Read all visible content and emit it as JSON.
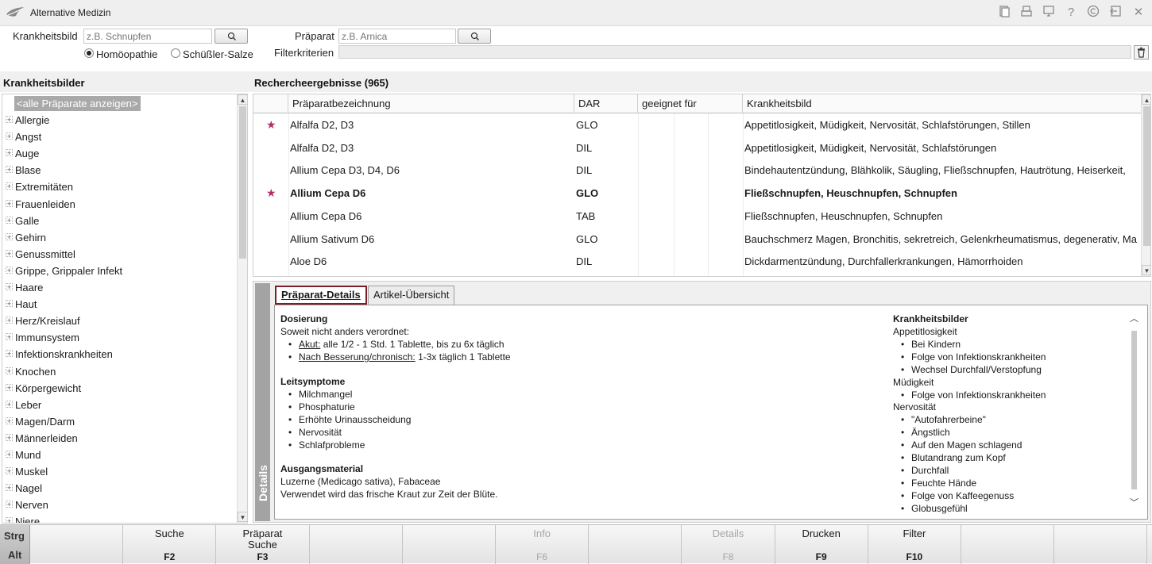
{
  "window": {
    "title": "Alternative Medizin"
  },
  "titlebar_icons": [
    "document-icon",
    "printer-icon",
    "monitor-icon",
    "help-icon",
    "copyright-icon",
    "exit-icon",
    "close-icon"
  ],
  "search": {
    "krankheitsbild_label": "Krankheitsbild",
    "krankheitsbild_placeholder": "z.B. Schnupfen",
    "praeparat_label": "Präparat",
    "praeparat_placeholder": "z.B. Arnica",
    "filter_label": "Filterkriterien",
    "radio_homoeopathie": "Homöopathie",
    "radio_schuessler": "Schüßler-Salze",
    "selected_radio": "Homöopathie"
  },
  "left": {
    "title": "Krankheitsbilder",
    "selected_item": "<alle Präparate anzeigen>",
    "items": [
      "Allergie",
      "Angst",
      "Auge",
      "Blase",
      "Extremitäten",
      "Frauenleiden",
      "Galle",
      "Gehirn",
      "Genussmittel",
      "Grippe, Grippaler Infekt",
      "Haare",
      "Haut",
      "Herz/Kreislauf",
      "Immunsystem",
      "Infektionskrankheiten",
      "Knochen",
      "Körpergewicht",
      "Leber",
      "Magen/Darm",
      "Männerleiden",
      "Mund",
      "Muskel",
      "Nagel",
      "Nerven",
      "Niere"
    ]
  },
  "results": {
    "title": "Rechercheergebnisse (965)",
    "columns": [
      "Präparatbezeichnung",
      "DAR",
      "geeignet für",
      "Krankheitsbild"
    ],
    "rows": [
      {
        "star": "★",
        "name": "Alfalfa D2, D3",
        "dar": "GLO",
        "krankheitsbild": "Appetitlosigkeit, Müdigkeit, Nervosität, Schlafstörungen, Stillen",
        "bold": false
      },
      {
        "star": "",
        "name": "Alfalfa D2, D3",
        "dar": "DIL",
        "krankheitsbild": "Appetitlosigkeit, Müdigkeit, Nervosität, Schlafstörungen",
        "bold": false
      },
      {
        "star": "",
        "name": "Allium Cepa D3, D4, D6",
        "dar": "DIL",
        "krankheitsbild": "Bindehautentzündung, Blähkolik, Säugling, Fließschnupfen, Hautrötung, Heiserkeit, ",
        "bold": false
      },
      {
        "star": "★",
        "name": "Allium Cepa D6",
        "dar": "GLO",
        "krankheitsbild": "Fließschnupfen, Heuschnupfen, Schnupfen",
        "bold": true
      },
      {
        "star": "",
        "name": "Allium Cepa D6",
        "dar": "TAB",
        "krankheitsbild": "Fließschnupfen, Heuschnupfen, Schnupfen",
        "bold": false
      },
      {
        "star": "",
        "name": "Allium Sativum D6",
        "dar": "GLO",
        "krankheitsbild": "Bauchschmerz Magen, Bronchitis, sekretreich, Gelenkrheumatismus, degenerativ, Ma",
        "bold": false
      },
      {
        "star": "",
        "name": "Aloe D6",
        "dar": "DIL",
        "krankheitsbild": "Dickdarmentzündung, Durchfallerkrankungen, Hämorrhoiden",
        "bold": false
      }
    ]
  },
  "details": {
    "side_label": "Details",
    "tabs": [
      "Präparat-Details",
      "Artikel-Übersicht"
    ],
    "active_tab": "Präparat-Details",
    "dosierung_heading": "Dosierung",
    "dosierung_intro": "Soweit nicht anders verordnet:",
    "dosierung_items": [
      {
        "label": "Akut:",
        "text": " alle 1/2 - 1 Std. 1 Tablette, bis zu 6x täglich"
      },
      {
        "label": "Nach Besserung/chronisch:",
        "text": " 1-3x täglich 1 Tablette"
      }
    ],
    "leitsymptome_heading": "Leitsymptome",
    "leitsymptome": [
      "Milchmangel",
      "Phosphaturie",
      "Erhöhte Urinausscheidung",
      "Nervosität",
      "Schlafprobleme"
    ],
    "ausgangsmaterial_heading": "Ausgangsmaterial",
    "ausgangsmaterial_lines": [
      "Luzerne (Medicago sativa), Fabaceae",
      "Verwendet wird das frische Kraut zur Zeit der Blüte."
    ],
    "krankheitsbilder_heading": "Krankheitsbilder",
    "krankheitsbilder_lines": [
      {
        "type": "group",
        "text": "Appetitlosigkeit"
      },
      {
        "type": "item",
        "text": "Bei Kindern"
      },
      {
        "type": "item",
        "text": "Folge von Infektionskrankheiten"
      },
      {
        "type": "item",
        "text": "Wechsel Durchfall/Verstopfung"
      },
      {
        "type": "group",
        "text": "Müdigkeit"
      },
      {
        "type": "item",
        "text": "Folge von Infektionskrankheiten"
      },
      {
        "type": "group",
        "text": "Nervosität"
      },
      {
        "type": "item",
        "text": "\"Autofahrerbeine\""
      },
      {
        "type": "item",
        "text": "Ängstlich"
      },
      {
        "type": "item",
        "text": "Auf den Magen schlagend"
      },
      {
        "type": "item",
        "text": "Blutandrang zum Kopf"
      },
      {
        "type": "item",
        "text": "Durchfall"
      },
      {
        "type": "item",
        "text": "Feuchte Hände"
      },
      {
        "type": "item",
        "text": "Folge von Kaffeegenuss"
      },
      {
        "type": "item",
        "text": "Globusgefühl"
      }
    ]
  },
  "fkeys": {
    "strg": "Strg",
    "alt": "Alt",
    "keys": [
      {
        "label": "",
        "key": "",
        "enabled": true
      },
      {
        "label": "Suche",
        "key": "F2",
        "enabled": true
      },
      {
        "label": "Präparat Suche",
        "key": "F3",
        "enabled": true
      },
      {
        "label": "",
        "key": "",
        "enabled": true
      },
      {
        "label": "",
        "key": "",
        "enabled": true
      },
      {
        "label": "Info",
        "key": "F6",
        "enabled": false
      },
      {
        "label": "",
        "key": "",
        "enabled": true
      },
      {
        "label": "Details",
        "key": "F8",
        "enabled": false
      },
      {
        "label": "Drucken",
        "key": "F9",
        "enabled": true
      },
      {
        "label": "Filter",
        "key": "F10",
        "enabled": true
      },
      {
        "label": "",
        "key": "",
        "enabled": true
      },
      {
        "label": "",
        "key": "",
        "enabled": true
      }
    ]
  },
  "colors": {
    "accent_star": "#b0306b",
    "tab_border": "#7a1f2b",
    "selection": "#a9a9a9"
  }
}
